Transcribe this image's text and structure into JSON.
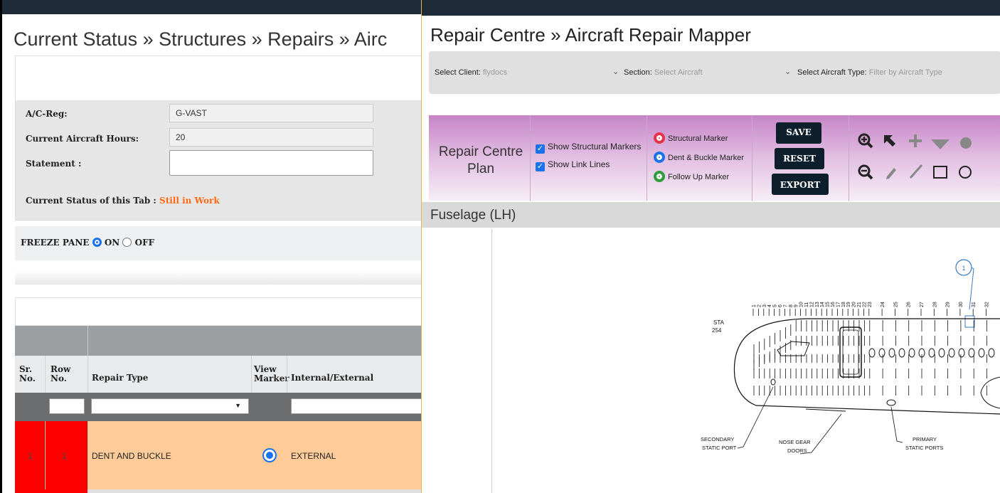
{
  "left": {
    "title": "Current Status » Structures » Repairs » Airc",
    "form": {
      "reg_label": "A/C-Reg:",
      "reg_value": "G-VAST",
      "hours_label": "Current Aircraft Hours:",
      "hours_value": "20",
      "statement_label": "Statement :",
      "status_label": "Current Status of this Tab :",
      "status_value": "Still in Work"
    },
    "freeze": {
      "label": "FREEZE PANE",
      "on": "ON",
      "off": "OFF"
    },
    "table": {
      "headers": {
        "sr": "Sr.\nNo.",
        "row": "Row\nNo.",
        "repair_type": "Repair Type",
        "view_marker": "View\nMarker",
        "int_ext": "Internal/External"
      },
      "filter_dropdown_arrow": "▼",
      "rows": [
        {
          "sr": "1",
          "row": "1",
          "repair_type": "DENT AND BUCKLE",
          "int_ext": "EXTERNAL"
        }
      ]
    }
  },
  "right": {
    "title": "Repair Centre » Aircraft Repair Mapper",
    "selects": {
      "client_label": "Select Client:",
      "client_value": "flydocs",
      "section_label": "Section:",
      "section_value": "Select Aircraft",
      "type_label": "Select Aircraft Type:",
      "type_value": "Filter by Aircraft Type"
    },
    "panel": {
      "title_line1": "Repair Centre",
      "title_line2": "Plan",
      "show_structural": "Show Structural Markers",
      "show_links": "Show Link Lines",
      "markers": [
        {
          "label": "Structural Marker",
          "color": "#e8344a"
        },
        {
          "label": "Dent & Buckle Marker",
          "color": "#1a73e8"
        },
        {
          "label": "Follow Up Marker",
          "color": "#2e9e3a"
        }
      ],
      "save": "SAVE",
      "reset": "RESET",
      "export": "EXPORT",
      "tools": [
        "zoom-in-icon",
        "pointer-icon",
        "plus-icon",
        "triangle-icon",
        "circle-fill-icon",
        "zoom-out-icon",
        "pencil-icon",
        "line-icon",
        "rect-icon",
        "circle-icon"
      ]
    },
    "section_title": "Fuselage (LH)",
    "drawing": {
      "marker_number": "1",
      "sta_label": "STA",
      "sta_value": "254",
      "frame_numbers": [
        "1",
        "2",
        "3",
        "4",
        "5",
        "6",
        "7",
        "8",
        "9",
        "10",
        "11",
        "12",
        "13",
        "14",
        "15",
        "16",
        "17",
        "18",
        "19",
        "20",
        "21",
        "22",
        "23",
        "24",
        "25",
        "26",
        "27",
        "28",
        "29",
        "30",
        "31",
        "32"
      ],
      "labels": {
        "secondary_1": "SECONDARY",
        "secondary_2": "STATIC PORT",
        "nose_1": "NOSE GEAR",
        "nose_2": "DOORS",
        "primary_1": "PRIMARY",
        "primary_2": "STATIC PORTS"
      }
    }
  }
}
